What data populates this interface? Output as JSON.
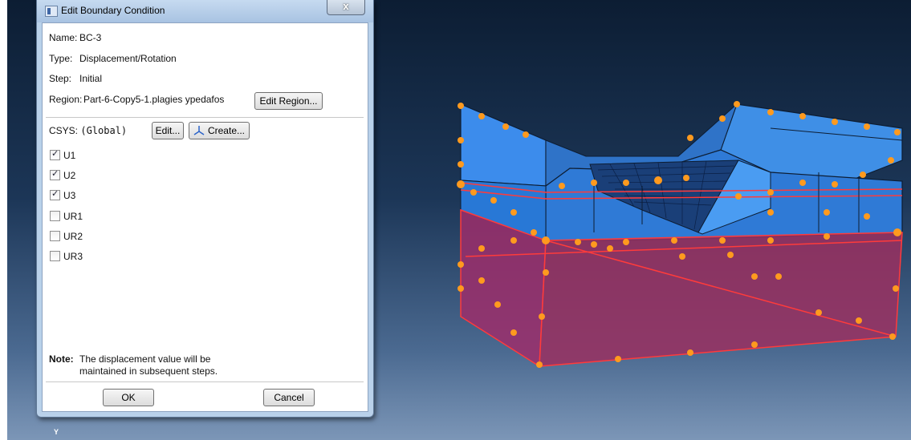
{
  "dialog": {
    "title": "Edit Boundary Condition",
    "close_label": "x",
    "name_label": "Name:",
    "name_value": "BC-3",
    "type_label": "Type:",
    "type_value": "Displacement/Rotation",
    "step_label": "Step:",
    "step_value": "Initial",
    "region_label": "Region:",
    "region_value": "Part-6-Copy5-1.plagies ypedafos",
    "edit_region_label": "Edit Region...",
    "csys_label": "CSYS:",
    "csys_value": "(Global)",
    "edit_label": "Edit...",
    "create_label": "Create...",
    "dofs": [
      {
        "label": "U1",
        "checked": true
      },
      {
        "label": "U2",
        "checked": true
      },
      {
        "label": "U3",
        "checked": true
      },
      {
        "label": "UR1",
        "checked": false
      },
      {
        "label": "UR2",
        "checked": false
      },
      {
        "label": "UR3",
        "checked": false
      }
    ],
    "note_label": "Note:",
    "note_line1": "The displacement value will be",
    "note_line2": "maintained in subsequent steps.",
    "ok_label": "OK",
    "cancel_label": "Cancel"
  },
  "viewport": {
    "axis_label": "Y",
    "colors": {
      "solid_face": "#2f7fd6",
      "solid_top": "#3d8ff0",
      "selected_region": "#e23030",
      "bc_marker": "#ff9a1e"
    }
  }
}
